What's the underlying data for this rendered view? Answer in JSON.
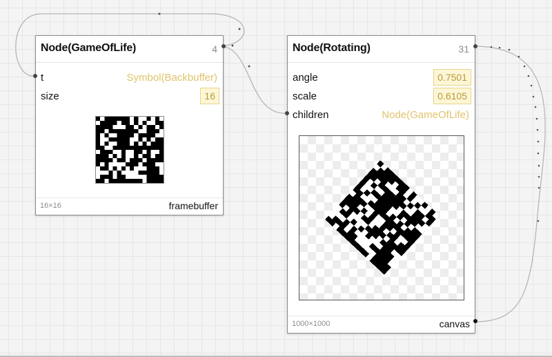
{
  "nodes": {
    "gameoflife": {
      "title": "Node(GameOfLife)",
      "id": "4",
      "params": {
        "t": {
          "label": "t",
          "value": "Symbol(Backbuffer)"
        },
        "size": {
          "label": "size",
          "value": "16"
        }
      },
      "footer": {
        "size": "16×16",
        "type": "framebuffer"
      }
    },
    "rotating": {
      "title": "Node(Rotating)",
      "id": "31",
      "params": {
        "angle": {
          "label": "angle",
          "value": "0.7501"
        },
        "scale": {
          "label": "scale",
          "value": "0.6105"
        },
        "children": {
          "label": "children",
          "value": "Node(GameOfLife)"
        }
      },
      "footer": {
        "size": "1000×1000",
        "type": "canvas"
      }
    }
  },
  "colors": {
    "symbol_text": "#e0c36a",
    "number_bg": "#fdf6d6",
    "wire": "#b0b0b0",
    "port": "#444444"
  }
}
